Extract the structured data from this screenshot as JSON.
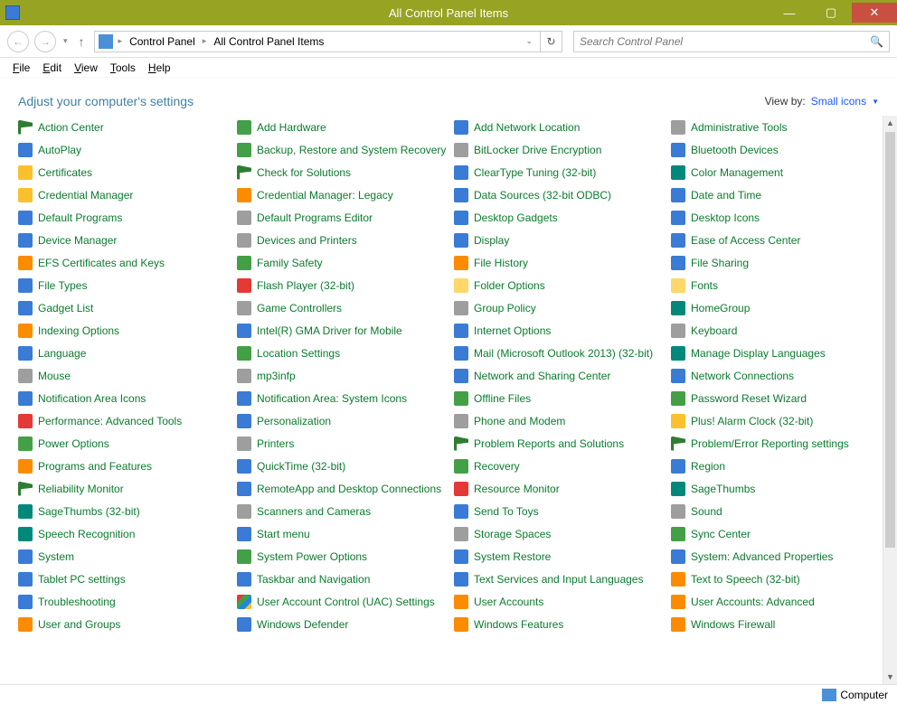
{
  "window": {
    "title": "All Control Panel Items",
    "minimize": "—",
    "maximize": "▢",
    "close": "✕"
  },
  "nav": {
    "back": "←",
    "forward": "→",
    "up": "↑",
    "refresh": "↻",
    "breadcrumb": [
      "Control Panel",
      "All Control Panel Items"
    ],
    "search_placeholder": "Search Control Panel"
  },
  "menus": [
    "File",
    "Edit",
    "View",
    "Tools",
    "Help"
  ],
  "header": {
    "title": "Adjust your computer's settings",
    "viewby_label": "View by:",
    "viewby_value": "Small icons"
  },
  "status": {
    "text": "Computer"
  },
  "items": [
    {
      "label": "Action Center",
      "icon": "c-flag"
    },
    {
      "label": "Add Hardware",
      "icon": "c-green"
    },
    {
      "label": "Add Network Location",
      "icon": "c-blue"
    },
    {
      "label": "Administrative Tools",
      "icon": "c-grey"
    },
    {
      "label": "AutoPlay",
      "icon": "c-blue"
    },
    {
      "label": "Backup, Restore and System Recovery",
      "icon": "c-green"
    },
    {
      "label": "BitLocker Drive Encryption",
      "icon": "c-grey"
    },
    {
      "label": "Bluetooth Devices",
      "icon": "c-blue"
    },
    {
      "label": "Certificates",
      "icon": "c-yellow"
    },
    {
      "label": "Check for Solutions",
      "icon": "c-flag"
    },
    {
      "label": "ClearType Tuning (32-bit)",
      "icon": "c-blue"
    },
    {
      "label": "Color Management",
      "icon": "c-teal"
    },
    {
      "label": "Credential Manager",
      "icon": "c-yellow"
    },
    {
      "label": "Credential Manager: Legacy",
      "icon": "c-orange"
    },
    {
      "label": "Data Sources (32-bit ODBC)",
      "icon": "c-blue"
    },
    {
      "label": "Date and Time",
      "icon": "c-blue"
    },
    {
      "label": "Default Programs",
      "icon": "c-blue"
    },
    {
      "label": "Default Programs Editor",
      "icon": "c-grey"
    },
    {
      "label": "Desktop Gadgets",
      "icon": "c-blue"
    },
    {
      "label": "Desktop Icons",
      "icon": "c-blue"
    },
    {
      "label": "Device Manager",
      "icon": "c-blue"
    },
    {
      "label": "Devices and Printers",
      "icon": "c-grey"
    },
    {
      "label": "Display",
      "icon": "c-blue"
    },
    {
      "label": "Ease of Access Center",
      "icon": "c-blue"
    },
    {
      "label": "EFS Certificates and Keys",
      "icon": "c-orange"
    },
    {
      "label": "Family Safety",
      "icon": "c-green"
    },
    {
      "label": "File History",
      "icon": "c-orange"
    },
    {
      "label": "File Sharing",
      "icon": "c-blue"
    },
    {
      "label": "File Types",
      "icon": "c-blue"
    },
    {
      "label": "Flash Player (32-bit)",
      "icon": "c-red"
    },
    {
      "label": "Folder Options",
      "icon": "c-folder"
    },
    {
      "label": "Fonts",
      "icon": "c-folder"
    },
    {
      "label": "Gadget List",
      "icon": "c-blue"
    },
    {
      "label": "Game Controllers",
      "icon": "c-grey"
    },
    {
      "label": "Group Policy",
      "icon": "c-grey"
    },
    {
      "label": "HomeGroup",
      "icon": "c-teal"
    },
    {
      "label": "Indexing Options",
      "icon": "c-orange"
    },
    {
      "label": "Intel(R) GMA Driver for Mobile",
      "icon": "c-blue"
    },
    {
      "label": "Internet Options",
      "icon": "c-blue"
    },
    {
      "label": "Keyboard",
      "icon": "c-grey"
    },
    {
      "label": "Language",
      "icon": "c-blue"
    },
    {
      "label": "Location Settings",
      "icon": "c-green"
    },
    {
      "label": "Mail (Microsoft Outlook 2013) (32-bit)",
      "icon": "c-blue"
    },
    {
      "label": "Manage Display Languages",
      "icon": "c-teal"
    },
    {
      "label": "Mouse",
      "icon": "c-grey"
    },
    {
      "label": "mp3infp",
      "icon": "c-grey"
    },
    {
      "label": "Network and Sharing Center",
      "icon": "c-blue"
    },
    {
      "label": "Network Connections",
      "icon": "c-blue"
    },
    {
      "label": "Notification Area Icons",
      "icon": "c-blue"
    },
    {
      "label": "Notification Area: System Icons",
      "icon": "c-blue"
    },
    {
      "label": "Offline Files",
      "icon": "c-green"
    },
    {
      "label": "Password Reset Wizard",
      "icon": "c-green"
    },
    {
      "label": "Performance: Advanced Tools",
      "icon": "c-red"
    },
    {
      "label": "Personalization",
      "icon": "c-blue"
    },
    {
      "label": "Phone and Modem",
      "icon": "c-grey"
    },
    {
      "label": "Plus! Alarm Clock (32-bit)",
      "icon": "c-yellow"
    },
    {
      "label": "Power Options",
      "icon": "c-green"
    },
    {
      "label": "Printers",
      "icon": "c-grey"
    },
    {
      "label": "Problem Reports and Solutions",
      "icon": "c-flag"
    },
    {
      "label": "Problem/Error Reporting settings",
      "icon": "c-flag"
    },
    {
      "label": "Programs and Features",
      "icon": "c-orange"
    },
    {
      "label": "QuickTime (32-bit)",
      "icon": "c-blue"
    },
    {
      "label": "Recovery",
      "icon": "c-green"
    },
    {
      "label": "Region",
      "icon": "c-blue"
    },
    {
      "label": "Reliability Monitor",
      "icon": "c-flag"
    },
    {
      "label": "RemoteApp and Desktop Connections",
      "icon": "c-blue"
    },
    {
      "label": "Resource Monitor",
      "icon": "c-red"
    },
    {
      "label": "SageThumbs",
      "icon": "c-teal"
    },
    {
      "label": "SageThumbs (32-bit)",
      "icon": "c-teal"
    },
    {
      "label": "Scanners and Cameras",
      "icon": "c-grey"
    },
    {
      "label": "Send To Toys",
      "icon": "c-blue"
    },
    {
      "label": "Sound",
      "icon": "c-grey"
    },
    {
      "label": "Speech Recognition",
      "icon": "c-teal"
    },
    {
      "label": "Start menu",
      "icon": "c-blue"
    },
    {
      "label": "Storage Spaces",
      "icon": "c-grey"
    },
    {
      "label": "Sync Center",
      "icon": "c-green"
    },
    {
      "label": "System",
      "icon": "c-blue"
    },
    {
      "label": "System Power Options",
      "icon": "c-green"
    },
    {
      "label": "System Restore",
      "icon": "c-blue"
    },
    {
      "label": "System: Advanced Properties",
      "icon": "c-blue"
    },
    {
      "label": "Tablet PC settings",
      "icon": "c-blue"
    },
    {
      "label": "Taskbar and Navigation",
      "icon": "c-blue"
    },
    {
      "label": "Text Services and Input Languages",
      "icon": "c-blue"
    },
    {
      "label": "Text to Speech (32-bit)",
      "icon": "c-orange"
    },
    {
      "label": "Troubleshooting",
      "icon": "c-blue"
    },
    {
      "label": "User Account Control (UAC) Settings",
      "icon": "c-shield"
    },
    {
      "label": "User Accounts",
      "icon": "c-orange"
    },
    {
      "label": "User Accounts: Advanced",
      "icon": "c-orange"
    },
    {
      "label": "User and Groups",
      "icon": "c-orange"
    },
    {
      "label": "Windows Defender",
      "icon": "c-blue"
    },
    {
      "label": "Windows Features",
      "icon": "c-orange"
    },
    {
      "label": "Windows Firewall",
      "icon": "c-orange"
    }
  ]
}
